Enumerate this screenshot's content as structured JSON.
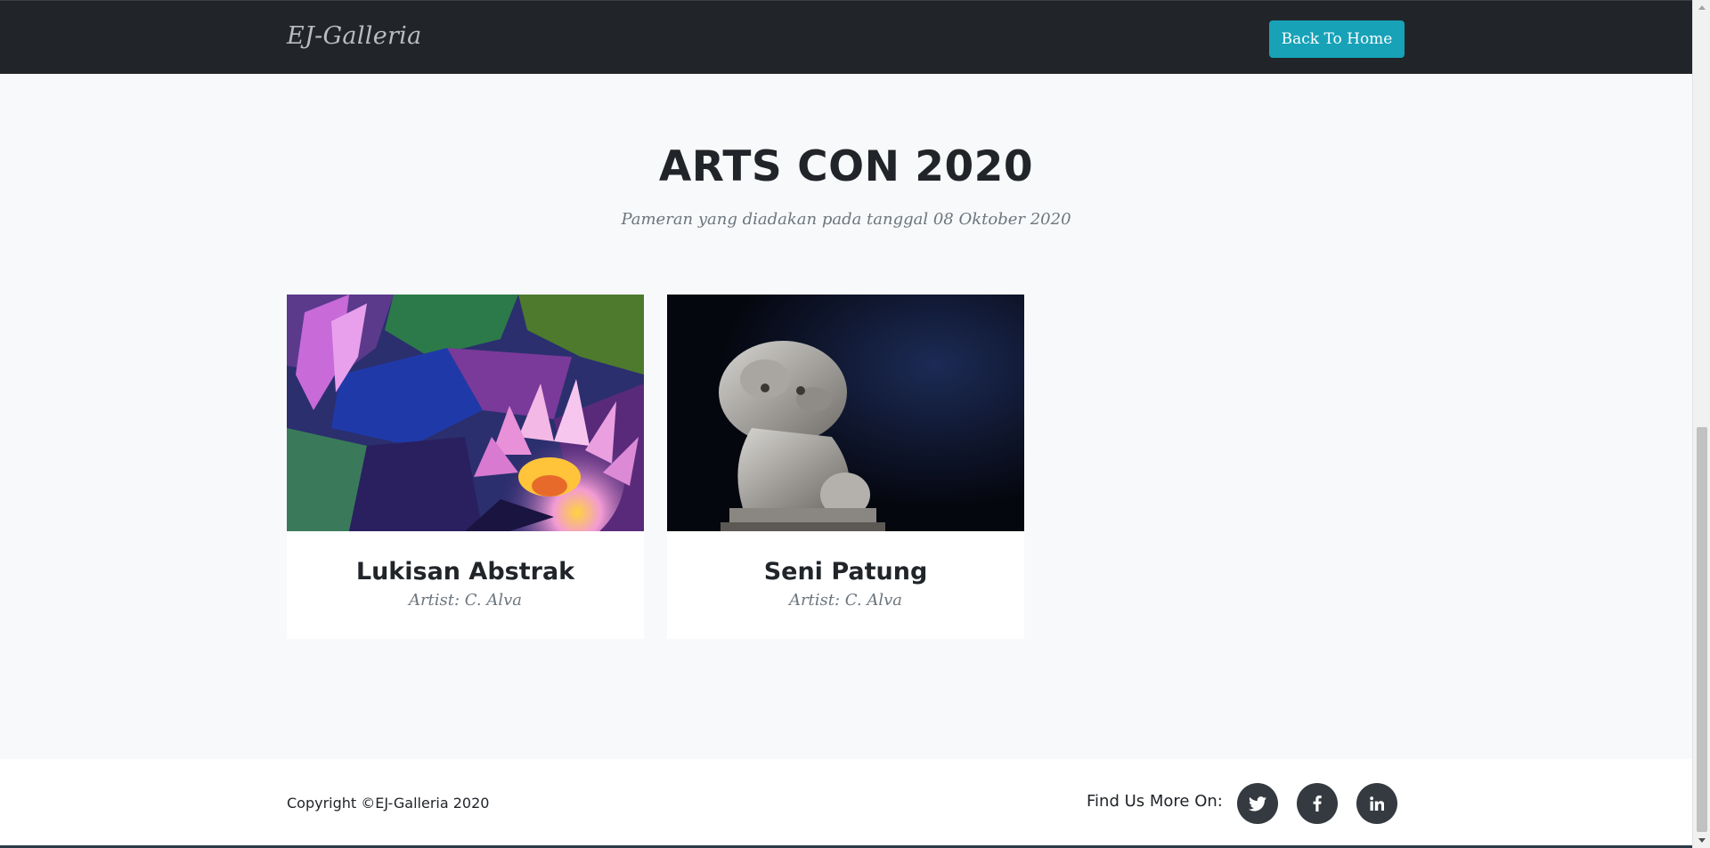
{
  "navbar": {
    "brand": "EJ-Galleria",
    "home_button": "Back To Home"
  },
  "exhibition": {
    "title": "ARTS CON 2020",
    "subtitle": "Pameran yang diadakan pada tanggal 08 Oktober 2020"
  },
  "cards": [
    {
      "title": "Lukisan Abstrak",
      "artist": "Artist: C. Alva",
      "image": "abstract-lotus-painting"
    },
    {
      "title": "Seni Patung",
      "artist": "Artist: C. Alva",
      "image": "stone-lion-statue"
    }
  ],
  "footer": {
    "copyright": "Copyright ©EJ-Galleria 2020",
    "find_us": "Find Us More On:",
    "social_icons": [
      "twitter-icon",
      "facebook-icon",
      "linkedin-icon"
    ]
  },
  "colors": {
    "navbar_bg": "#212529",
    "accent": "#17a2b8",
    "page_bg": "#f8f9fa",
    "social_bg": "#343a40"
  }
}
